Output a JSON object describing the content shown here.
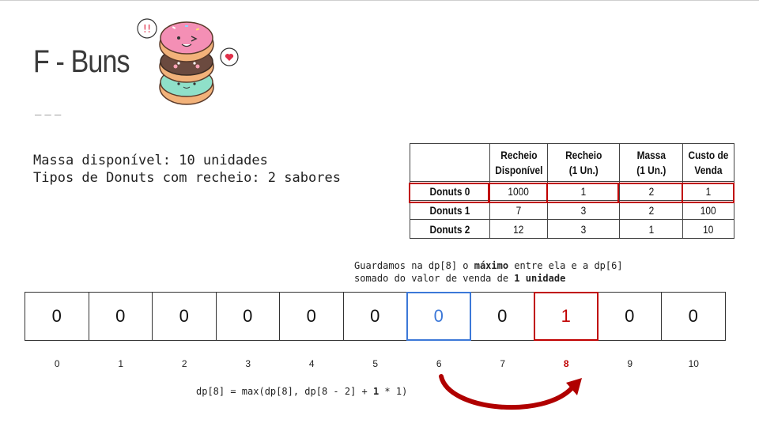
{
  "title": "F - Buns",
  "title_underline": "___",
  "info": {
    "line1": "Massa disponível: 10 unidades",
    "line2": "Tipos de Donuts com recheio: 2 sabores"
  },
  "table": {
    "headers": [
      "",
      "Recheio Disponível",
      "Recheio (1 Un.)",
      "Massa (1 Un.)",
      "Custo de Venda"
    ],
    "header_lines": [
      [
        "",
        ""
      ],
      [
        "Recheio",
        "Disponível"
      ],
      [
        "Recheio",
        "(1 Un.)"
      ],
      [
        "Massa",
        "(1 Un.)"
      ],
      [
        "Custo de",
        "Venda"
      ]
    ],
    "rows": [
      [
        "Donuts 0",
        "1000",
        "1",
        "2",
        "1"
      ],
      [
        "Donuts 1",
        "7",
        "3",
        "2",
        "100"
      ],
      [
        "Donuts 2",
        "12",
        "3",
        "1",
        "10"
      ]
    ],
    "highlighted_row": 0
  },
  "note": {
    "line1_a": "Guardamos na dp[8] o ",
    "line1_b": "máximo",
    "line1_c": " entre ela e a dp[6]",
    "line2_a": "somado do valor de venda de ",
    "line2_b": "1 unidade"
  },
  "dp": {
    "values": [
      "0",
      "0",
      "0",
      "0",
      "0",
      "0",
      "0",
      "0",
      "1",
      "0",
      "0"
    ],
    "indices": [
      "0",
      "1",
      "2",
      "3",
      "4",
      "5",
      "6",
      "7",
      "8",
      "9",
      "10"
    ],
    "source_index": 6,
    "target_index": 8
  },
  "formula": {
    "part1": "dp[8] = max(dp[8], dp[8 - 2] + ",
    "part2": "1",
    "part3": " * 1)"
  },
  "colors": {
    "highlight_red": "#c00000",
    "highlight_blue": "#3c78d8"
  }
}
